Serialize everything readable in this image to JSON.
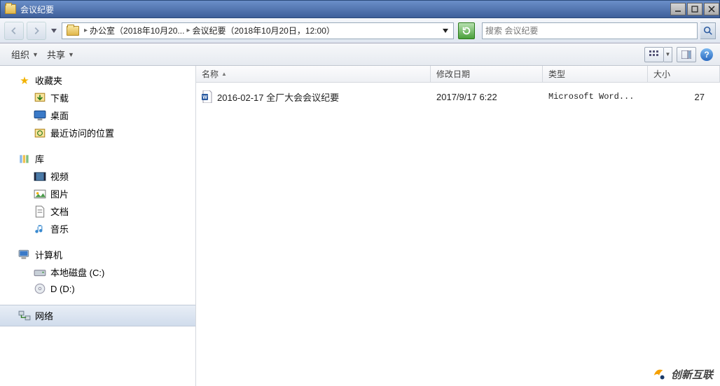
{
  "window": {
    "title": "会议纪要"
  },
  "breadcrumb": {
    "part1": "办公室（2018年10月20...",
    "part2": "会议纪要（2018年10月20日，12:00）"
  },
  "search": {
    "placeholder": "搜索 会议纪要"
  },
  "toolbar": {
    "organize": "组织",
    "share": "共享"
  },
  "sidebar": {
    "favorites": "收藏夹",
    "downloads": "下载",
    "desktop": "桌面",
    "recent": "最近访问的位置",
    "libraries": "库",
    "videos": "视频",
    "pictures": "图片",
    "documents": "文档",
    "music": "音乐",
    "computer": "计算机",
    "localdisk": "本地磁盘 (C:)",
    "ddrive": "D (D:)",
    "network": "网络"
  },
  "columns": {
    "name": "名称",
    "date": "修改日期",
    "type": "类型",
    "size": "大小"
  },
  "files": [
    {
      "name": "2016-02-17 全厂大会会议纪要",
      "date": "2017/9/17 6:22",
      "type": "Microsoft Word...",
      "size": "27"
    }
  ],
  "watermark": "创新互联"
}
